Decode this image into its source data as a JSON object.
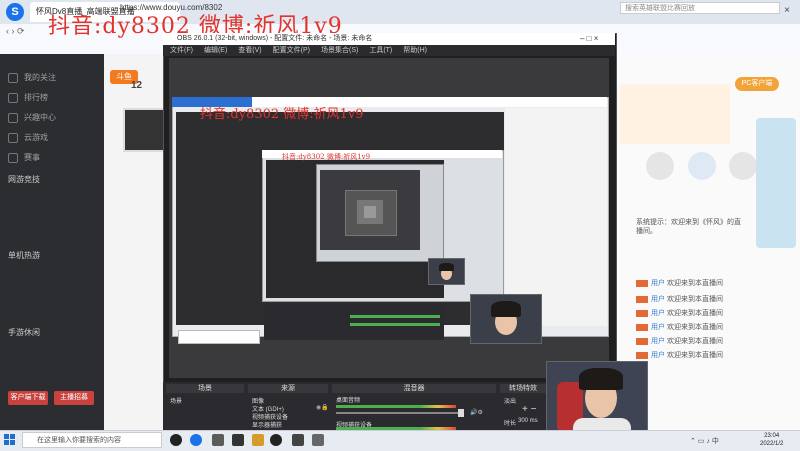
{
  "browser": {
    "tab_title": "怀风Dv8直播_高端联盟直播",
    "url": "https://www.douyu.com/8302",
    "search_placeholder": "搜索英雄联盟比赛回放"
  },
  "watermark": "抖音:dy8302 微博:祈风1v9",
  "nested_watermark": "抖音:dy8302 微博:祈风1v9",
  "sidebar": {
    "items": [
      "我的关注",
      "排行榜",
      "兴趣中心",
      "云游戏",
      "赛事"
    ],
    "section_headers": [
      "网游竞技",
      "单机热游",
      "手游休闲"
    ],
    "buttons": [
      "客户端下载",
      "主播招募"
    ]
  },
  "streamer": {
    "fans_count": "12"
  },
  "right_panel": {
    "download_label": "PC客户端",
    "chat_intro": "系统提示：欢迎来到《怀风》的直播间。",
    "chat_lines": [
      "欢迎来到本直播间",
      "欢迎来到本直播间",
      "欢迎来到本直播间",
      "欢迎来到本直播间",
      "欢迎来到本直播间",
      "欢迎来到本直播间"
    ]
  },
  "obs": {
    "title": "OBS 26.0.1 (32-bit, windows) - 配置文件: 未命名 - 场景: 未命名",
    "menu": [
      "文件(F)",
      "编辑(E)",
      "查看(V)",
      "配置文件(P)",
      "场景集合(S)",
      "工具(T)",
      "帮助(H)"
    ],
    "docks": {
      "scenes_title": "场景",
      "sources_title": "来源",
      "mixer_title": "混音器",
      "transition_title": "转场特效",
      "scene_item": "场景",
      "sources": [
        "图像",
        "文本 (GDI+)",
        "视频捕获设备",
        "显示器捕获"
      ],
      "mixer_tracks": [
        "桌面音频",
        "视频捕获设备"
      ],
      "transition_type": "淡出",
      "duration_label": "时长",
      "duration_value": "300 ms"
    }
  },
  "taskbar": {
    "search_placeholder": "在这里输入你要搜索的内容",
    "time": "23:04",
    "date": "2022/1/2"
  }
}
